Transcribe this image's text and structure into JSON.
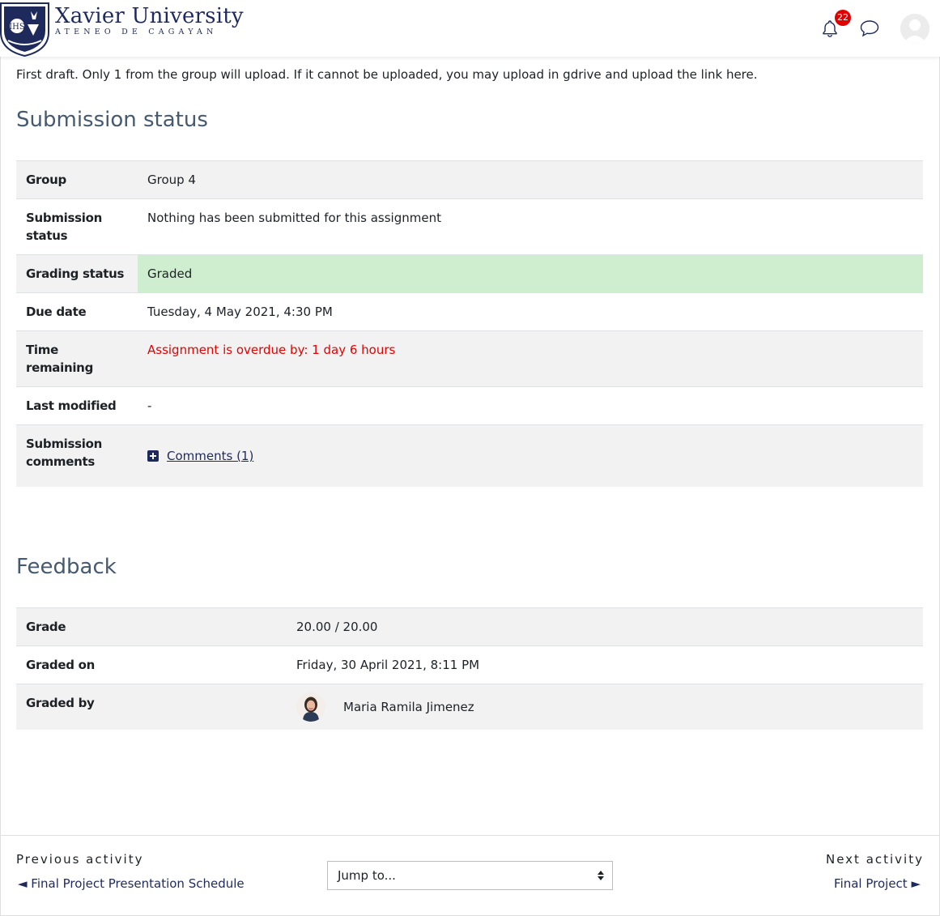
{
  "header": {
    "logo_name": "Xavier University",
    "logo_subtitle": "ATENEO DE CAGAYAN",
    "notification_count": "22",
    "icons": [
      "bell-icon",
      "chat-icon",
      "user-avatar"
    ]
  },
  "intro_text": "First draft. Only 1 from the group will upload. If it cannot be uploaded, you may upload in gdrive and upload the link here.",
  "submission": {
    "heading": "Submission status",
    "rows": [
      {
        "label": "Group",
        "value": "Group 4"
      },
      {
        "label": "Submission status",
        "value": "Nothing has been submitted for this assignment"
      },
      {
        "label": "Grading status",
        "value": "Graded"
      },
      {
        "label": "Due date",
        "value": "Tuesday, 4 May 2021, 4:30 PM"
      },
      {
        "label": "Time remaining",
        "value": "Assignment is overdue by: 1 day 6 hours"
      },
      {
        "label": "Last modified",
        "value": "-"
      },
      {
        "label": "Submission comments",
        "value": "Comments (1)"
      }
    ]
  },
  "feedback": {
    "heading": "Feedback",
    "rows": [
      {
        "label": "Grade",
        "value": "20.00 / 20.00"
      },
      {
        "label": "Graded on",
        "value": "Friday, 30 April 2021, 8:11 PM"
      },
      {
        "label": "Graded by",
        "value": "Maria Ramila Jimenez"
      }
    ]
  },
  "activity_nav": {
    "previous_heading": "Previous activity",
    "previous_link": "◄ Final Project Presentation Schedule",
    "jump_placeholder": "Jump to...",
    "next_heading": "Next activity",
    "next_link": "Final Project ►"
  },
  "colors": {
    "brand": "#1f2a5c",
    "heading": "#455a70",
    "graded_bg": "#cfeecf",
    "overdue": "#e60000",
    "badge": "#e00000"
  }
}
